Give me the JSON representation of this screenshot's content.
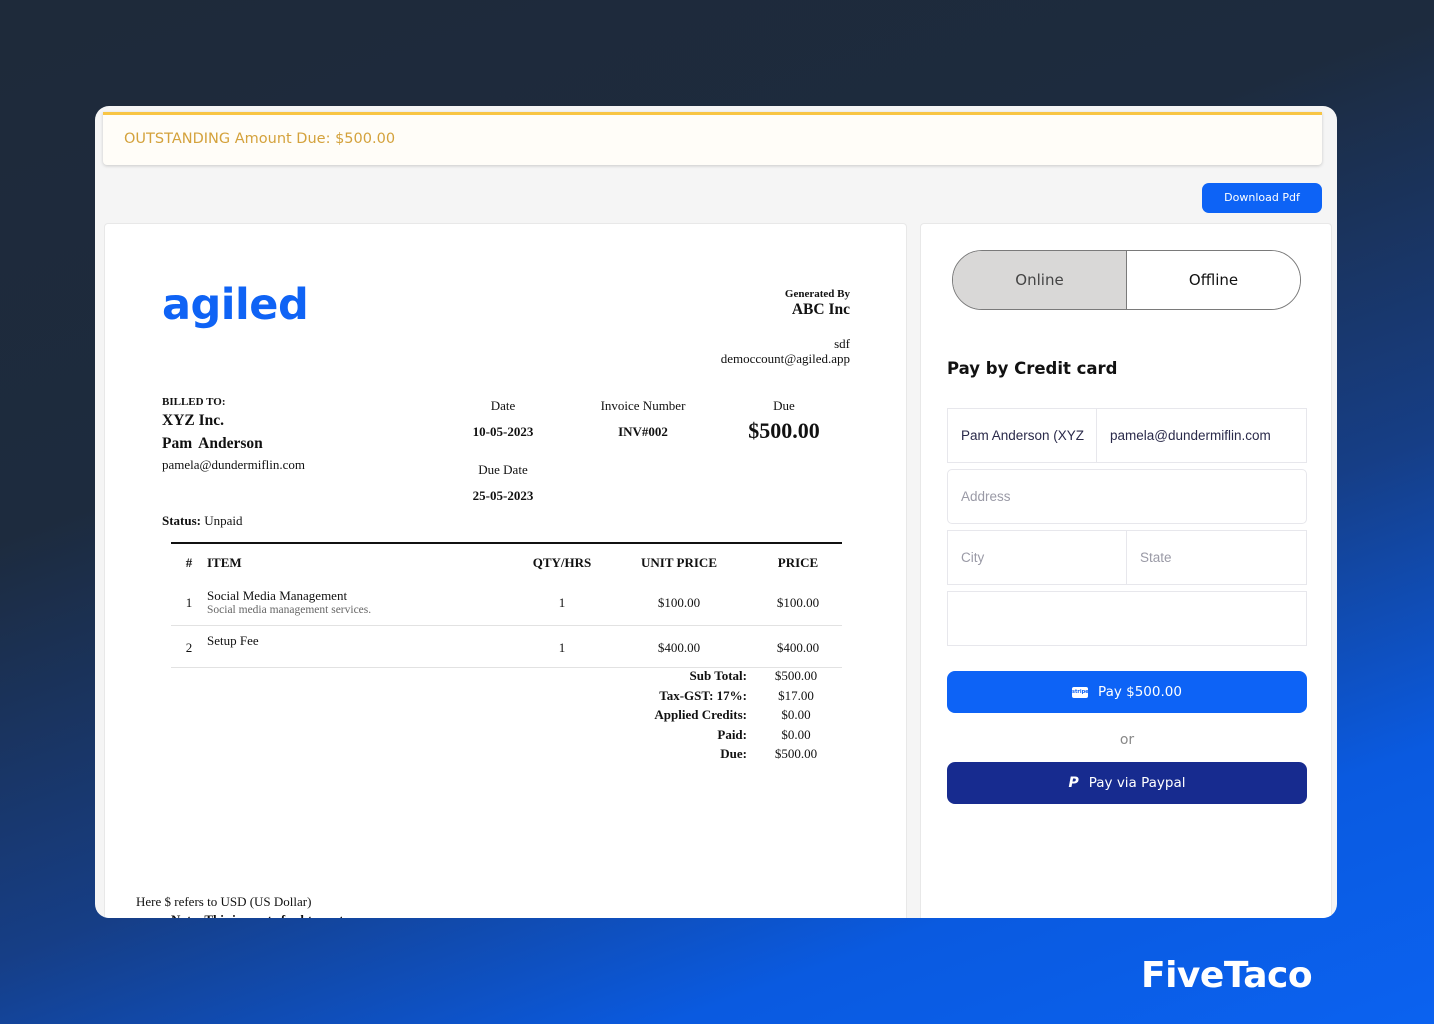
{
  "banner": {
    "text": "OUTSTANDING Amount Due: $500.00"
  },
  "toolbar": {
    "download_label": "Download Pdf"
  },
  "invoice": {
    "logo": "agiled",
    "generated_by": {
      "label": "Generated By",
      "company": "ABC Inc",
      "address": "sdf",
      "email": "democcount@agiled.app"
    },
    "billed_to": {
      "label": "BILLED TO:",
      "company": "XYZ Inc.",
      "person": "Pam  Anderson",
      "email": "pamela@dundermiflin.com"
    },
    "date": {
      "label": "Date",
      "value": "10-05-2023"
    },
    "due_date": {
      "label": "Due Date",
      "value": "25-05-2023"
    },
    "invoice_number": {
      "label": "Invoice Number",
      "value": "INV#002"
    },
    "due": {
      "label": "Due",
      "value": "$500.00"
    },
    "status": {
      "label": "Status:",
      "value": "Unpaid"
    },
    "table": {
      "headers": [
        "#",
        "ITEM",
        "QTY/HRS",
        "UNIT PRICE",
        "PRICE"
      ],
      "rows": [
        {
          "num": "1",
          "item": "Social Media Management",
          "desc": "Social media management services.",
          "qty": "1",
          "unit_price": "$100.00",
          "price": "$100.00"
        },
        {
          "num": "2",
          "item": "Setup Fee",
          "desc": "",
          "qty": "1",
          "unit_price": "$400.00",
          "price": "$400.00"
        }
      ]
    },
    "totals": [
      {
        "label": "Sub Total:",
        "value": "$500.00"
      },
      {
        "label": "Tax-GST: 17%:",
        "value": "$17.00"
      },
      {
        "label": "Applied Credits:",
        "value": "$0.00"
      },
      {
        "label": "Paid:",
        "value": "$0.00"
      },
      {
        "label": "Due:",
        "value": "$500.00"
      }
    ],
    "currency_note": "Here $ refers to USD (US Dollar)",
    "note": "Note: This is a note for bte customer"
  },
  "payment": {
    "tabs": [
      {
        "label": "Online",
        "active": true
      },
      {
        "label": "Offline",
        "active": false
      }
    ],
    "title": "Pay by Credit card",
    "fields": {
      "name": {
        "value": "Pam Anderson (XYZ"
      },
      "email": {
        "value": "pamela@dundermiflin.com"
      },
      "address": {
        "placeholder": "Address"
      },
      "city": {
        "placeholder": "City"
      },
      "state": {
        "placeholder": "State"
      },
      "card": {
        "placeholder": ""
      }
    },
    "pay_button": {
      "label": "Pay $500.00",
      "icon": "stripe-icon",
      "icon_text": "stripe"
    },
    "or_label": "or",
    "paypal_button": {
      "label": "Pay via Paypal",
      "icon": "paypal-icon",
      "icon_text": "P"
    }
  },
  "brand": {
    "watermark": "FiveTaco"
  },
  "colors": {
    "accent": "#0d63f6",
    "paypal": "#172b8f",
    "banner_border": "#f8c544",
    "banner_text": "#d4a23c",
    "toggle_active": "#d9d8d7"
  }
}
